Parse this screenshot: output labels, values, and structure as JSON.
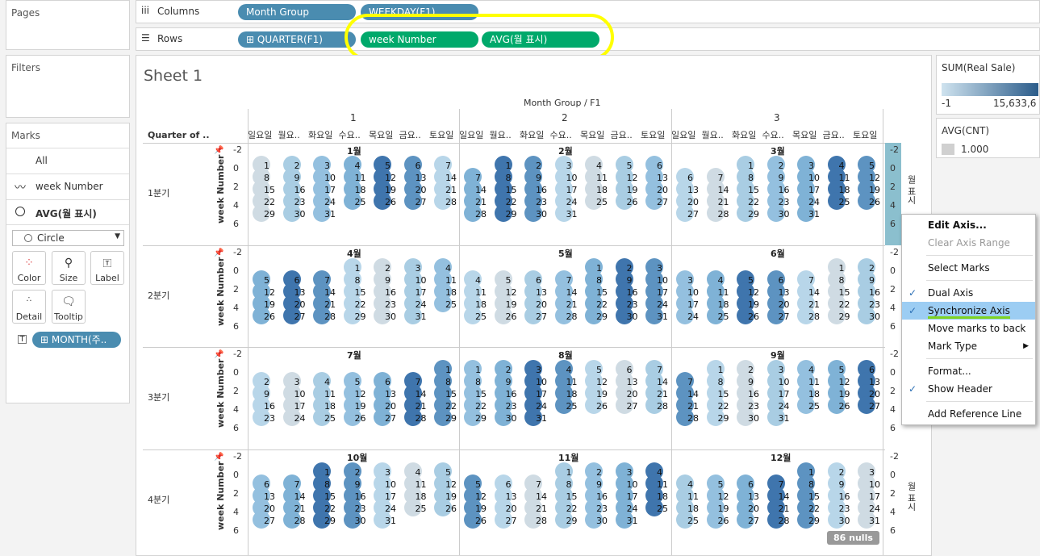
{
  "pages": {
    "title": "Pages"
  },
  "filters": {
    "title": "Filters"
  },
  "marks": {
    "title": "Marks",
    "all": "All",
    "week_number": "week Number",
    "avg_label": "AVG(월 표시)",
    "mark_type": "Circle",
    "cards": [
      "Color",
      "Size",
      "Label",
      "Detail",
      "Tooltip"
    ],
    "month_pill": "MONTH(주.."
  },
  "columns": {
    "label": "Columns",
    "pills": [
      "Month Group",
      "WEEKDAY(F1)"
    ]
  },
  "rows": {
    "label": "Rows",
    "pills": [
      "QUARTER(F1)",
      "week Number",
      "AVG(월 표시)"
    ]
  },
  "sheet": {
    "title": "Sheet 1",
    "header": "Month Group / F1",
    "quarter_header": "Quarter of ..",
    "groups": [
      "1",
      "2",
      "3"
    ],
    "weekdays": [
      "일요일",
      "월요..",
      "화요일",
      "수요..",
      "목요일",
      "금요..",
      "토요일"
    ],
    "quarters": [
      "1분기",
      "2분기",
      "3분기",
      "4분기"
    ],
    "axis_title": "week Number",
    "ticks": [
      "-2",
      "0",
      "2",
      "4",
      "6"
    ],
    "right_axis_title": "월 표시",
    "months": [
      "1월",
      "2월",
      "3월",
      "4월",
      "5월",
      "6월",
      "7월",
      "8월",
      "9월",
      "10월",
      "11월",
      "12월"
    ],
    "nulls": "86 nulls"
  },
  "legend": {
    "sum_title": "SUM(Real Sale)",
    "min": "-1",
    "max": "15,633,6",
    "avg_title": "AVG(CNT)",
    "avg_value": "1.000"
  },
  "context_menu": {
    "items": [
      "Edit Axis...",
      "Clear Axis Range",
      "Select Marks",
      "Dual Axis",
      "Synchronize Axis",
      "Move marks to back",
      "Mark Type",
      "Format...",
      "Show Header",
      "Add Reference Line"
    ]
  },
  "colors": {
    "accent_blue": "#4a8cb0",
    "green": "#00a96b",
    "highlight": "#ffff00",
    "menu_selected": "#9ccdf3"
  }
}
